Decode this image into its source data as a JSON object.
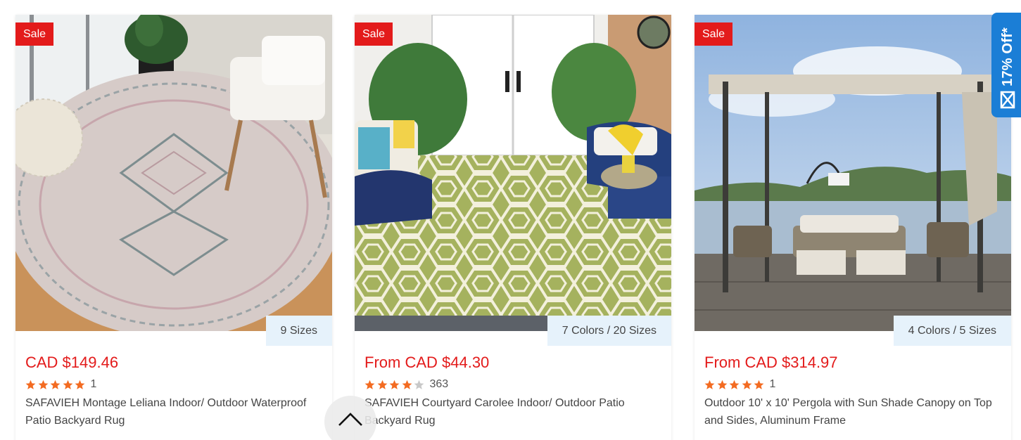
{
  "products": [
    {
      "badge": "Sale",
      "options": "9 Sizes",
      "price": "CAD $149.46",
      "rating": 5,
      "review_count": "1",
      "title": "SAFAVIEH Montage Leliana Indoor/ Outdoor Waterproof Patio Backyard Rug",
      "image": "round-rug-room-photo"
    },
    {
      "badge": "Sale",
      "options": "7 Colors / 20 Sizes",
      "price": "From CAD $44.30",
      "rating": 4,
      "review_count": "363",
      "title": "SAFAVIEH Courtyard Carolee Indoor/ Outdoor Patio Backyard Rug",
      "image": "hexagon-patio-rug-photo"
    },
    {
      "badge": "Sale",
      "options": "4 Colors / 5 Sizes",
      "price": "From CAD $314.97",
      "rating": 5,
      "review_count": "1",
      "title": "Outdoor 10' x 10' Pergola with Sun Shade Canopy on Top and Sides, Aluminum Frame",
      "image": "pergola-lake-photo"
    }
  ],
  "promo_tab": {
    "label": "17% Off*",
    "icon": "envelope-icon"
  },
  "scroll_top": {
    "icon": "chevron-up-icon"
  },
  "colors": {
    "sale_red": "#e31b1b",
    "price_red": "#e31b1b",
    "star_orange": "#f36b21",
    "star_empty": "#c8c8c8",
    "promo_blue": "#1b7ed6",
    "options_bg": "#e6f2fb"
  }
}
